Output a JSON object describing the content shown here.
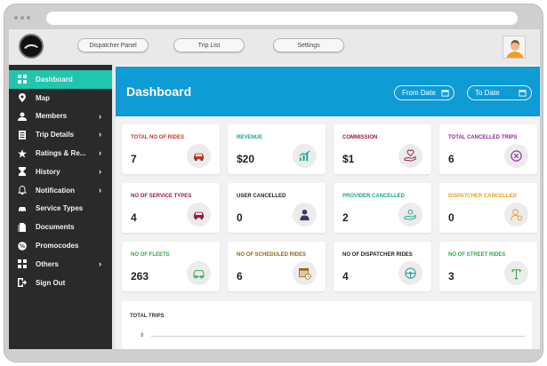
{
  "window": {
    "tabs": [
      "Dispatcher Panel",
      "Trip List",
      "Settings"
    ]
  },
  "sidebar": {
    "items": [
      {
        "label": "Dashboard",
        "icon": "dashboard-icon",
        "chevron": false
      },
      {
        "label": "Map",
        "icon": "map-pin-icon",
        "chevron": false
      },
      {
        "label": "Members",
        "icon": "members-icon",
        "chevron": true
      },
      {
        "label": "Trip Details",
        "icon": "trip-details-icon",
        "chevron": true
      },
      {
        "label": "Ratings & Re...",
        "icon": "star-icon",
        "chevron": true
      },
      {
        "label": "History",
        "icon": "history-icon",
        "chevron": true
      },
      {
        "label": "Notification",
        "icon": "bell-icon",
        "chevron": true
      },
      {
        "label": "Service Types",
        "icon": "car-icon",
        "chevron": false
      },
      {
        "label": "Documents",
        "icon": "document-icon",
        "chevron": false
      },
      {
        "label": "Promocodes",
        "icon": "promocode-icon",
        "chevron": false
      },
      {
        "label": "Others",
        "icon": "grid-icon",
        "chevron": true
      },
      {
        "label": "Sign Out",
        "icon": "sign-out-icon",
        "chevron": false
      }
    ],
    "chevron_glyph": "›"
  },
  "banner": {
    "title": "Dashboard",
    "from_date": "From Date",
    "to_date": "To Date"
  },
  "cards": [
    {
      "title": "TOTAL NO OF RIDES",
      "value": "7",
      "color": "#c0392b",
      "icon": "car-icon"
    },
    {
      "title": "REVENUE",
      "value": "$20",
      "color": "#1aa58e",
      "icon": "revenue-chart-icon"
    },
    {
      "title": "COMMISSION",
      "value": "$1",
      "color": "#9b1c3e",
      "icon": "commission-hand-icon"
    },
    {
      "title": "TOTAL CANCELLED TRIPS",
      "value": "6",
      "color": "#8e2a9e",
      "icon": "cancel-circle-icon"
    },
    {
      "title": "NO OF SERVICE TYPES",
      "value": "4",
      "color": "#9b1c3e",
      "icon": "car-icon"
    },
    {
      "title": "USER CANCELLED",
      "value": "0",
      "color": "#222222",
      "icon": "user-icon"
    },
    {
      "title": "PROVIDER CANCELLED",
      "value": "2",
      "color": "#1aa58e",
      "icon": "provider-hand-icon"
    },
    {
      "title": "DISPATCHER CANCELLED",
      "value": "0",
      "color": "#e8a020",
      "icon": "dispatcher-icon"
    },
    {
      "title": "NO OF FLEETS",
      "value": "263",
      "color": "#2eaa4a",
      "icon": "car-outline-icon"
    },
    {
      "title": "NO OF SCHEDULED RIDES",
      "value": "6",
      "color": "#8a6a1a",
      "icon": "calendar-clock-icon"
    },
    {
      "title": "NO OF DISPATCHER RIDES",
      "value": "4",
      "color": "#222222",
      "icon": "steering-wheel-icon"
    },
    {
      "title": "NO OF STREET RIDES",
      "value": "3",
      "color": "#2eaa4a",
      "icon": "street-lamp-icon"
    }
  ],
  "total_trips": {
    "title": "TOTAL TRIPS",
    "tick": "8"
  }
}
